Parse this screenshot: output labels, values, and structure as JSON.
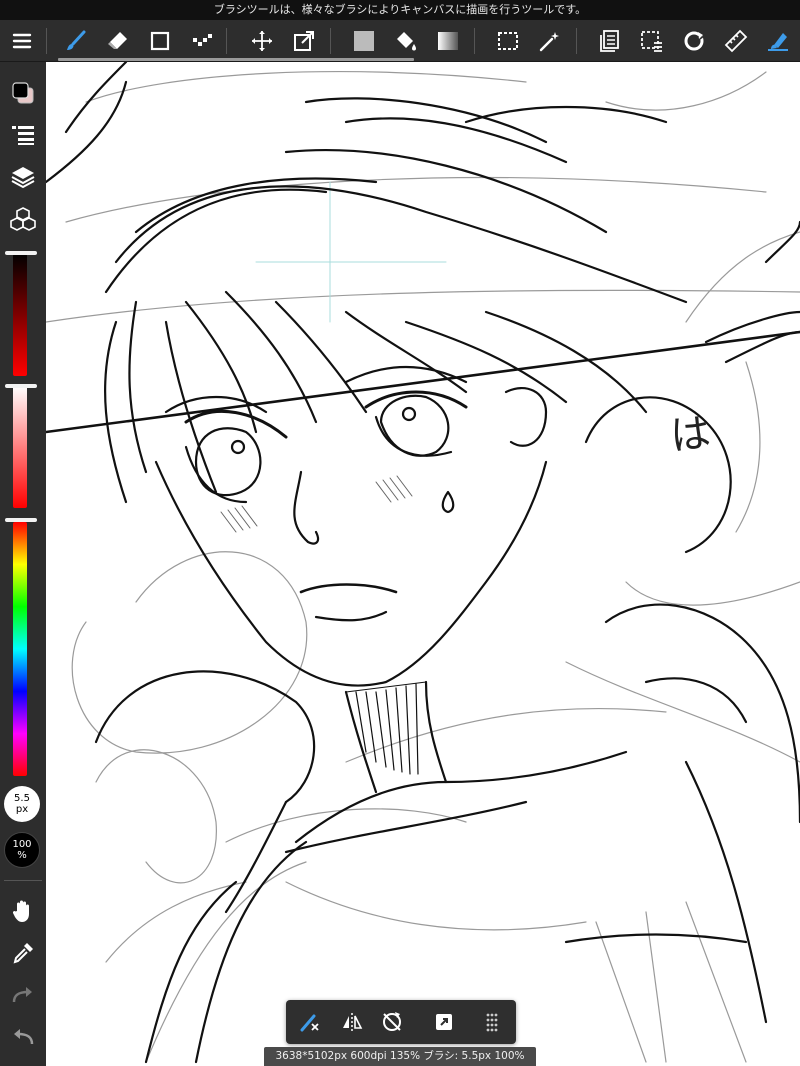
{
  "info_bar": {
    "text": "ブラシツールは、様々なブラシによりキャンバスに描画を行うツールです。"
  },
  "toolbar": {
    "tools": [
      {
        "name": "menu",
        "icon": "hamburger-icon",
        "color": "#ffffff"
      },
      {
        "name": "brush",
        "icon": "brush-icon",
        "color": "#3d9be9",
        "active": true
      },
      {
        "name": "eraser",
        "icon": "eraser-icon",
        "color": "#ffffff"
      },
      {
        "name": "shape",
        "icon": "square-icon",
        "color": "#ffffff"
      },
      {
        "name": "dot",
        "icon": "dot-tool-icon",
        "color": "#ffffff"
      },
      {
        "name": "move",
        "icon": "move-icon",
        "color": "#ffffff"
      },
      {
        "name": "transform",
        "icon": "transform-icon",
        "color": "#ffffff"
      },
      {
        "name": "fill-color",
        "icon": "filled-square-icon",
        "color": "#bbbbbb"
      },
      {
        "name": "bucket",
        "icon": "paint-bucket-icon",
        "color": "#ffffff"
      },
      {
        "name": "gradient",
        "icon": "gradient-icon",
        "color": "#ffffff"
      },
      {
        "name": "select",
        "icon": "dashed-rect-icon",
        "color": "#ffffff"
      },
      {
        "name": "magic-wand",
        "icon": "magic-wand-icon",
        "color": "#ffffff"
      },
      {
        "name": "layer-list",
        "icon": "pages-icon",
        "color": "#ffffff"
      },
      {
        "name": "select-layer",
        "icon": "select-layer-icon",
        "color": "#ffffff"
      },
      {
        "name": "rotate",
        "icon": "rotate-icon",
        "color": "#ffffff"
      },
      {
        "name": "ruler",
        "icon": "ruler-icon",
        "color": "#ffffff"
      },
      {
        "name": "snap-brush",
        "icon": "snap-brush-icon",
        "color": "#3d9be9"
      }
    ]
  },
  "sidebar": {
    "brush_size": {
      "value": "5.5",
      "unit": "px"
    },
    "opacity": {
      "value": "100",
      "unit": "%"
    },
    "primary_color": "#000000",
    "secondary_color": "#e8c8c8",
    "brightness_level": 1.0,
    "saturation_level": 1.0,
    "hue_level": 0.0
  },
  "status_bar": {
    "text": "3638*5102px 600dpi 135% ブラシ: 5.5px 100%"
  },
  "canvas": {
    "handwritten_text": "は"
  }
}
